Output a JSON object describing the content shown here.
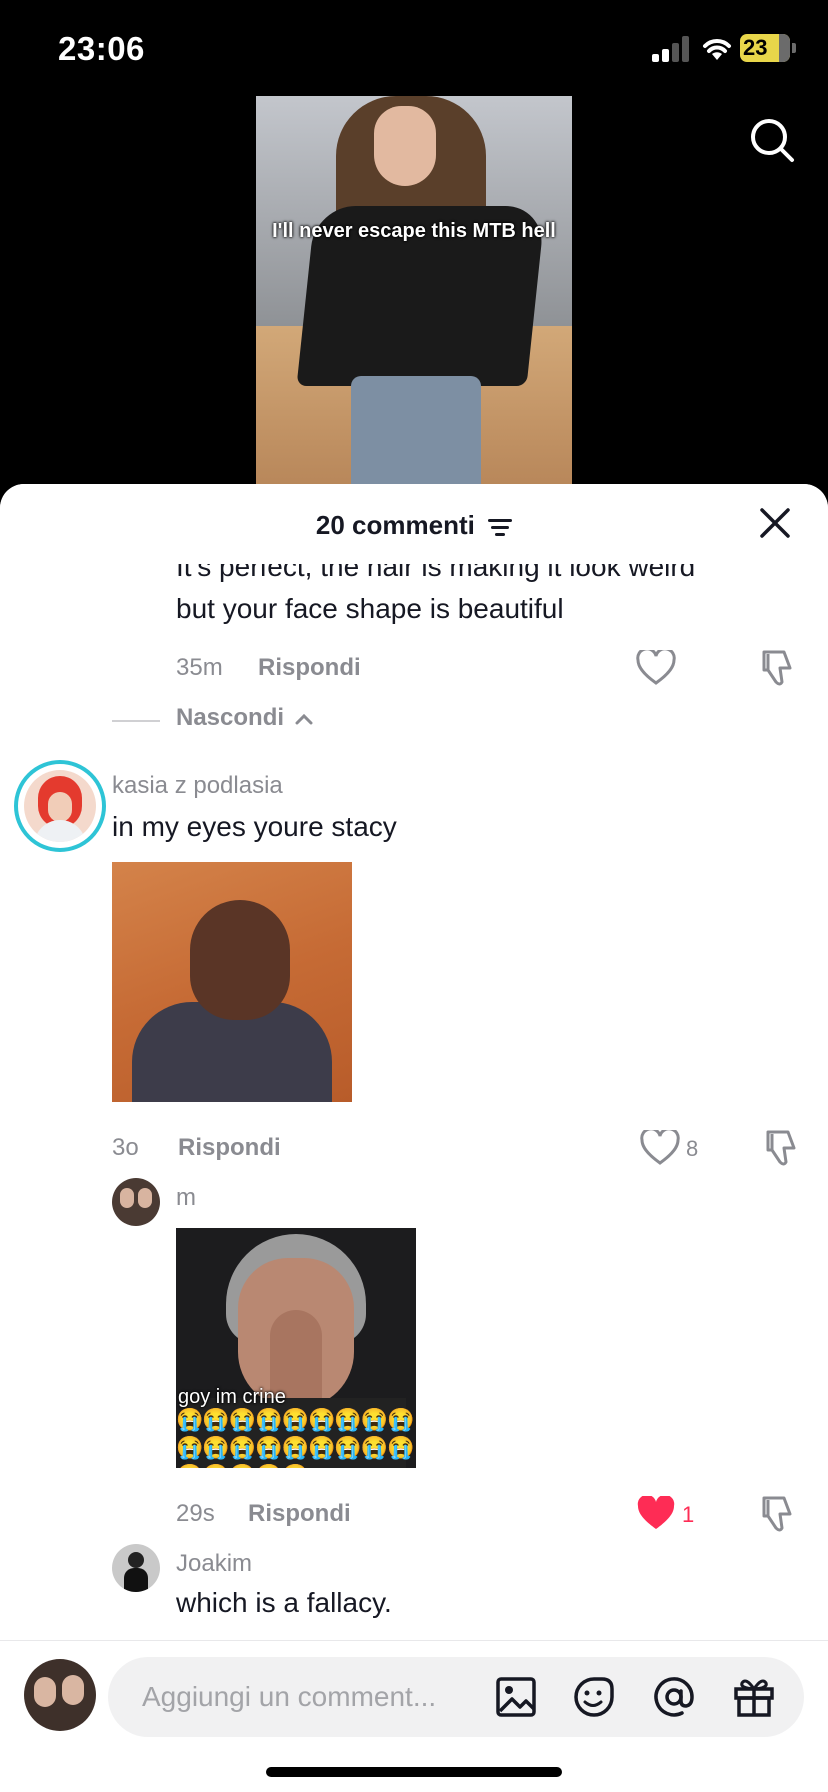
{
  "status_bar": {
    "time": "23:06",
    "battery": "23"
  },
  "video": {
    "caption": "I'll never escape this MTB hell"
  },
  "comments_header": {
    "count_label": "20 commenti"
  },
  "comments": [
    {
      "text_line1": "It’s perfect, the hair is making it look weird",
      "text_line2": "but your face shape is beautiful",
      "time": "35m",
      "reply_label": "Rispondi"
    },
    {
      "hide_replies_label": "Nascondi"
    },
    {
      "username": "kasia z podlasia",
      "text": "in my eyes youre stacy",
      "time": "3o",
      "reply_label": "Rispondi",
      "likes": "8"
    },
    {
      "username": "m",
      "gif_text": "goy im crine",
      "gif_emojis": "😭😭😭😭😭😭😭😭😭😭😭😭😭😭😭😭😭😭😭😭😭😭😭",
      "time": "29s",
      "reply_label": "Rispondi",
      "likes": "1"
    },
    {
      "username": "Joakim",
      "text": "which is a fallacy."
    }
  ],
  "composer": {
    "placeholder": "Aggiungi un comment..."
  },
  "colors": {
    "like_red": "#fe2c55",
    "muted": "#8a8b91",
    "story_ring": "#2ec4d6"
  },
  "icons": [
    "search-icon",
    "filter-icon",
    "close-icon",
    "heart-icon",
    "dislike-icon",
    "image-icon",
    "emoji-icon",
    "at-icon",
    "gift-icon"
  ]
}
